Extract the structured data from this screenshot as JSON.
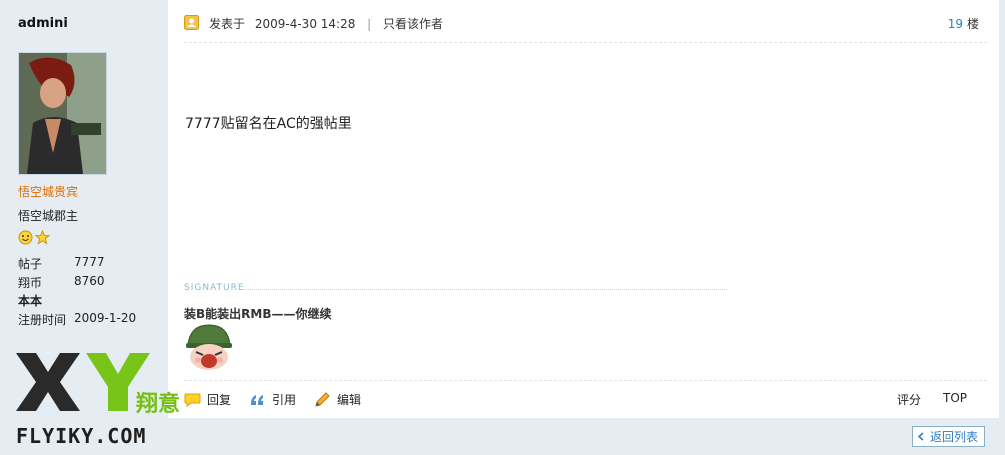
{
  "author": {
    "username": "admini",
    "usergroup": "悟空城贵宾",
    "title": "悟空城郡主",
    "stats": [
      {
        "label": "帖子",
        "value": "7777"
      },
      {
        "label": "翔币",
        "value": "8760"
      },
      {
        "label": "本本",
        "value": ""
      },
      {
        "label": "注册时间",
        "value": "2009-1-20"
      }
    ],
    "rank_icons": [
      "smiley-icon",
      "star-icon"
    ]
  },
  "post": {
    "posted_label": "发表于",
    "posted_at": "2009-4-30 14:28",
    "only_author_link": "只看该作者",
    "floor_number": "19",
    "floor_label": "楼",
    "content": "7777贴留名在AC的强帖里",
    "signature_label": "SIGNATURE",
    "signature_text": "装B能装出RMB——你继续"
  },
  "actions": {
    "reply": "回复",
    "quote": "引用",
    "edit": "编辑",
    "rate": "评分",
    "top": "TOP"
  },
  "footer": {
    "back_to_list": "返回列表"
  },
  "watermark": {
    "letters": "XY",
    "cn": "翔意",
    "site": "FLYIKY.COM"
  },
  "colors": {
    "sidebar_bg": "#e5edf2",
    "usergroup": "#e06b00",
    "link": "#2e7cc1",
    "logo_green": "#76bf16"
  }
}
